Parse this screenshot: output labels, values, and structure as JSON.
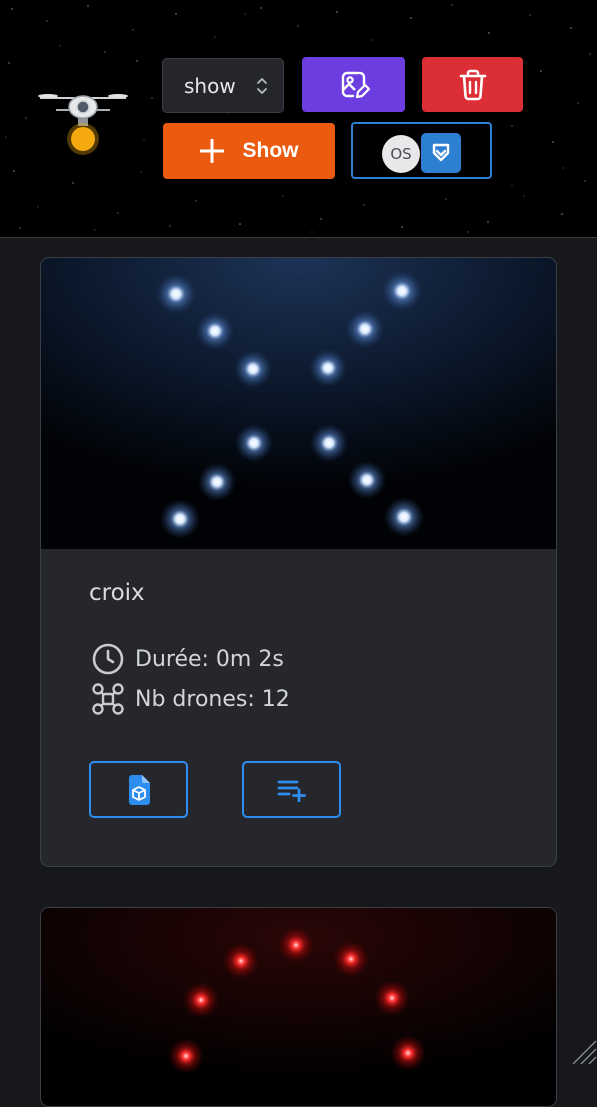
{
  "header": {
    "show_select": {
      "selected": "show"
    },
    "add_button": {
      "label": "Show",
      "icon": "plus-icon"
    },
    "image_button": {
      "icon": "image-edit-icon"
    },
    "delete_button": {
      "icon": "trash-icon"
    },
    "switch_button": {
      "os_label": "OS",
      "brand_icon": "chevron-shield-icon"
    }
  },
  "shows": [
    {
      "title": "croix",
      "duration": "Durée: 0m 2s",
      "drones": "Nb drones: 12",
      "duration_icon": "clock-icon",
      "drones_icon": "drone-icon",
      "actions": [
        "file-3d-icon",
        "playlist-add-icon"
      ]
    }
  ],
  "colors": {
    "purple": "#6c3ee0",
    "red": "#dc2f35",
    "orange": "#eb5b0f",
    "blue": "#2d8ef0",
    "drone_blue": "#bcd9ff",
    "drone_red": "#ff2a2a"
  }
}
